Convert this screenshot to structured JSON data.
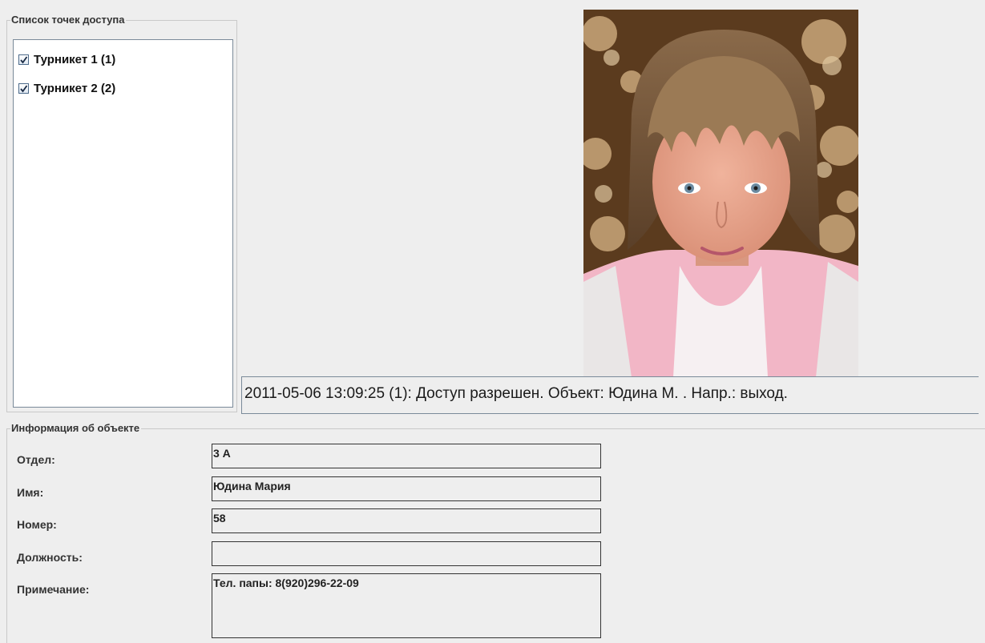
{
  "access_points": {
    "title": "Список точек доступа",
    "items": [
      {
        "label": "Турникет 1 (1)",
        "checked": true
      },
      {
        "label": "Турникет 2 (2)",
        "checked": true
      }
    ]
  },
  "event": {
    "text": "2011-05-06 13:09:25 (1): Доступ разрешен. Объект: Юдина М. . Напр.: выход."
  },
  "object_info": {
    "title": "Информация об объекте",
    "fields": [
      {
        "label": "Отдел:",
        "value": "3 А"
      },
      {
        "label": "Имя:",
        "value": "Юдина Мария"
      },
      {
        "label": "Номер:",
        "value": "58"
      },
      {
        "label": "Должность:",
        "value": ""
      },
      {
        "label": "Примечание:",
        "value": "Тел. папы: 8(920)296-22-09"
      }
    ]
  },
  "colors": {
    "background": "#eeeeee",
    "list_background": "#ffffff",
    "border": "#7a8a99",
    "field_border": "#333333"
  }
}
